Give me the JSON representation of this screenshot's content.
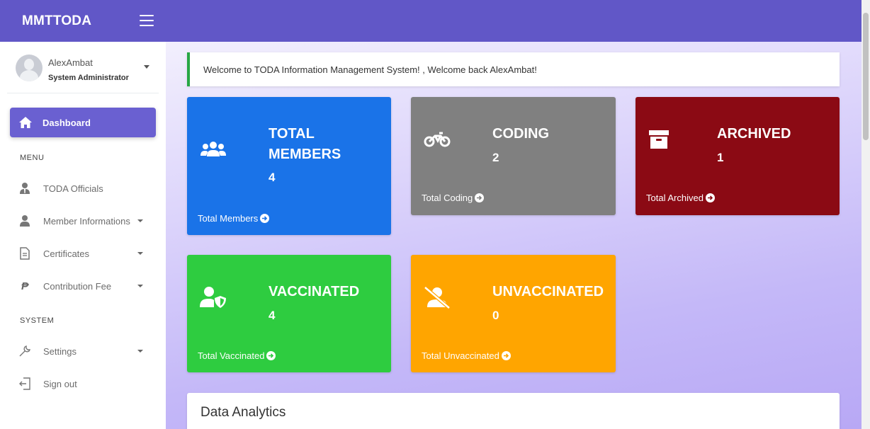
{
  "brand": "MMTTODA",
  "user": {
    "name": "AlexAmbat",
    "role": "System Administrator"
  },
  "nav": {
    "active": "Dashboard",
    "menu_title": "MENU",
    "menu_items": [
      {
        "label": "TODA Officials",
        "icon": "officials-icon",
        "has_caret": false
      },
      {
        "label": "Member Informations",
        "icon": "user-icon",
        "has_caret": true
      },
      {
        "label": "Certificates",
        "icon": "document-icon",
        "has_caret": true
      },
      {
        "label": "Contribution Fee",
        "icon": "peso-icon",
        "has_caret": true
      }
    ],
    "system_title": "SYSTEM",
    "system_items": [
      {
        "label": "Settings",
        "icon": "wrench-icon",
        "has_caret": true
      },
      {
        "label": "Sign out",
        "icon": "sign-out-icon",
        "has_caret": false
      }
    ]
  },
  "alert": {
    "message": "Welcome to TODA Information Management System! , Welcome back AlexAmbat!"
  },
  "cards": [
    {
      "title_line1": "TOTAL",
      "title_line2": "MEMBERS",
      "count": "4",
      "footer": "Total Members",
      "color": "#1a73e8",
      "icon": "users-icon"
    },
    {
      "title_line1": "CODING",
      "count": "2",
      "footer": "Total Coding",
      "color": "#808080",
      "icon": "motorcycle-icon"
    },
    {
      "title_line1": "ARCHIVED",
      "count": "1",
      "footer": "Total Archived",
      "color": "#8b0a14",
      "icon": "archive-icon"
    },
    {
      "title_line1": "VACCINATED",
      "count": "4",
      "footer": "Total Vaccinated",
      "color": "#2ecc40",
      "icon": "user-shield-icon"
    },
    {
      "title_line1": "UNVACCINATED",
      "count": "0",
      "footer": "Total Unvaccinated",
      "color": "#ffa500",
      "icon": "user-slash-icon"
    }
  ],
  "analytics": {
    "title": "Data Analytics"
  }
}
